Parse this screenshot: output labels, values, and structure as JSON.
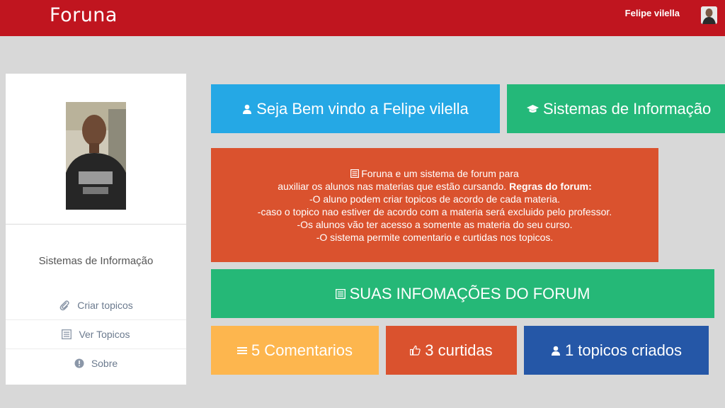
{
  "header": {
    "brand": "Foruna",
    "username": "Felipe vilella"
  },
  "sidebar": {
    "course": "Sistemas de Informação",
    "items": [
      {
        "label": "Criar topicos",
        "icon": "paperclip-icon"
      },
      {
        "label": "Ver Topicos",
        "icon": "list-icon"
      },
      {
        "label": "Sobre",
        "icon": "info-icon"
      }
    ]
  },
  "tiles": {
    "welcome": "Seja Bem vindo a Felipe vilella",
    "course": "Sistemas de Informação",
    "info": "SUAS INFOMAÇÕES DO FORUM",
    "comments": "5 Comentarios",
    "likes": "3 curtidas",
    "topics": "1 topicos criados"
  },
  "about": {
    "line1": "Foruna e um sistema de forum para",
    "line2": "auxiliar os alunos nas materias que estão cursando.",
    "rules_label": "Regras do forum:",
    "line3": "-O aluno podem criar topicos de acordo de cada materia.",
    "line4": "-caso o topico nao estiver de acordo com a materia será excluido pelo professor.",
    "line5": "-Os alunos vão ter acesso a somente as materia do seu curso.",
    "line6": "-O sistema permite comentario e curtidas nos topicos."
  },
  "colors": {
    "header": "#c0151f",
    "blue": "#25a8e5",
    "green": "#24b879",
    "orange_red": "#da522e",
    "yellow": "#fdb64e",
    "navy": "#2557a7"
  }
}
